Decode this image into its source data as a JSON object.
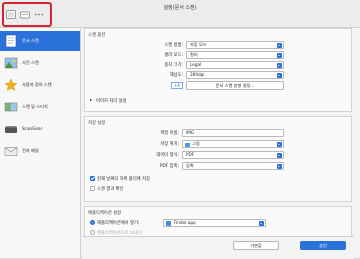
{
  "window": {
    "title": "설정(문서 스캔)"
  },
  "sidebar": {
    "items": [
      {
        "label": "문서 스캔",
        "icon": "document-scan-icon",
        "selected": true
      },
      {
        "label": "사진 스캔",
        "icon": "photo-scan-icon",
        "selected": false
      },
      {
        "label": "사용자 정의 스캔",
        "icon": "custom-scan-icon",
        "selected": false
      },
      {
        "label": "스캔 및 스티치",
        "icon": "scan-stitch-icon",
        "selected": false
      },
      {
        "label": "ScanGear",
        "icon": "scangear-icon",
        "selected": false
      },
      {
        "label": "전자 메일",
        "icon": "email-icon",
        "selected": false
      }
    ]
  },
  "scan_options": {
    "title": "스캔 옵션",
    "source_label": "스캔 방법:",
    "source_value": "자동 모드",
    "color_label": "컬러 모드:",
    "color_value": "컬러",
    "paper_label": "용지 크기:",
    "paper_value": "Legal",
    "resolution_label": "해상도:",
    "resolution_value": "300dpi",
    "setup_button": "문서 스캔 방향 설정...",
    "image_processing": "이미지 처리 설정"
  },
  "save_settings": {
    "title": "저장 설정",
    "filename_label": "파일 이름:",
    "filename_value": "IMG",
    "save_in_label": "저장 위치:",
    "save_in_value": "그림",
    "data_format_label": "데이터 형식:",
    "data_format_value": "PDF",
    "pdf_compression_label": "PDF 압축:",
    "pdf_compression_value": "압축",
    "check_save_subfolder": "현재 날짜의 하위 폴더에 저장",
    "check_results": "스캔 결과 확인"
  },
  "app_settings": {
    "title": "애플리케이션 설정",
    "open_with_label": "애플리케이션에서 열기:",
    "open_with_value": "Finder.app",
    "send_to_label": "애플리케이션으로 보내기:"
  },
  "footer": {
    "defaults_button": "기본값",
    "ok_button": "승인"
  },
  "colors": {
    "accent": "#2a72d9",
    "highlight": "#d6262d"
  }
}
